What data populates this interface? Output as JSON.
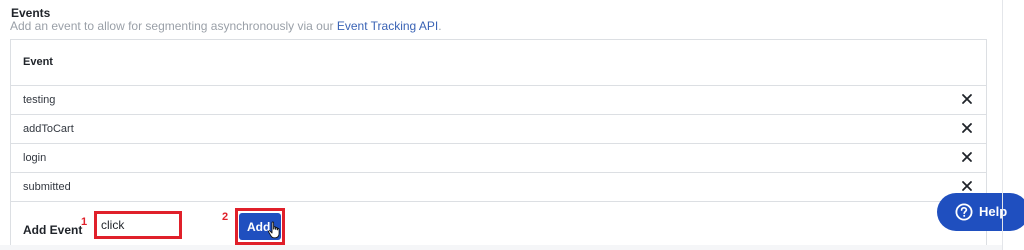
{
  "events_section": {
    "title": "Events",
    "description": "Add an event to allow for segmenting asynchronously via our ",
    "link_text": "Event Tracking API",
    "description_end": "."
  },
  "table": {
    "header": "Event",
    "rows": [
      {
        "name": "testing",
        "remove_icon": "close-icon"
      },
      {
        "name": "addToCart",
        "remove_icon": "close-icon"
      },
      {
        "name": "login",
        "remove_icon": "close-icon"
      },
      {
        "name": "submitted",
        "remove_icon": "close-icon"
      }
    ]
  },
  "add_event": {
    "label": "Add Event",
    "input_value": "click",
    "button_label": "Add"
  },
  "annotations": {
    "marker_1": "1",
    "marker_2": "2",
    "color": "#e0202a"
  },
  "help": {
    "label": "Help",
    "icon": "question-circle-icon"
  },
  "colors": {
    "accent": "#1f4fbf",
    "link": "#3a63b5",
    "muted_text": "#9aa0a8",
    "border": "#dcdfe3"
  }
}
